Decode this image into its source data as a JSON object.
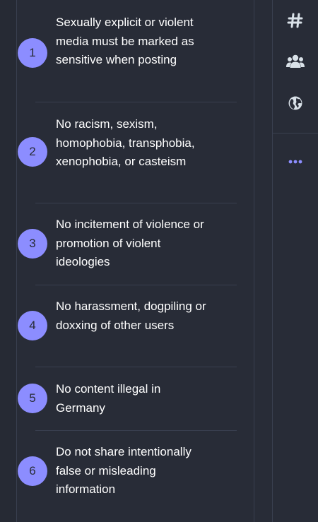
{
  "rules": [
    {
      "number": "1",
      "text": "Sexually explicit or violent media must be marked as sensitive when posting"
    },
    {
      "number": "2",
      "text": "No racism, sexism, homophobia, transphobia, xenophobia, or casteism"
    },
    {
      "number": "3",
      "text": "No incitement of violence or promotion of violent ideologies"
    },
    {
      "number": "4",
      "text": "No harassment, dogpiling or doxxing of other users"
    },
    {
      "number": "5",
      "text": "No content illegal in Germany"
    },
    {
      "number": "6",
      "text": "Do not share intentionally false or misleading information"
    }
  ],
  "nav": {
    "icons": [
      "hashtag-icon",
      "users-icon",
      "globe-icon",
      "more-icon"
    ]
  },
  "colors": {
    "background": "#282c37",
    "accent": "#8c8dff",
    "divider": "#393f4f",
    "text": "#ffffff",
    "icon": "#d9e1e8"
  }
}
